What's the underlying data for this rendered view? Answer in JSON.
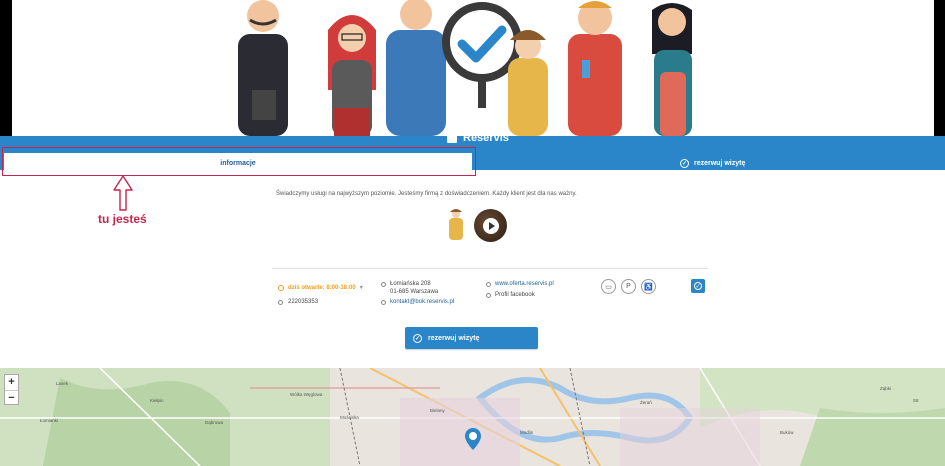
{
  "brand": {
    "name": "Reservis"
  },
  "tabs": {
    "info_label": "informacje",
    "book_label": "rezerwuj wizytę"
  },
  "annotation": {
    "text": "tu jesteś"
  },
  "description": "Świadczymy usługi na najwyższym poziomie. Jesteśmy firmą z doświadczeniem. Każdy klient jest dla nas ważny.",
  "contact": {
    "hours": "dziś otwarte: 8:00-18:00",
    "phone": "222035353",
    "address_line1": "Łomiańska 208",
    "address_line2": "01-685 Warszawa",
    "email": "kontakt@bok.reservis.pl",
    "website": "www.oferta.reservis.pl",
    "facebook": "Profil facebook"
  },
  "cta": {
    "label": "rezerwuj wizytę"
  },
  "map": {
    "zoom_in": "+",
    "zoom_out": "−",
    "labels": [
      "Lasek",
      "Łomianki",
      "Kiełpin",
      "Dąbrowa",
      "Wólka Węglowa",
      "Mościska",
      "Bielany",
      "Żerań",
      "Ząbki",
      "S8",
      "Modlin",
      "Buków"
    ]
  },
  "colors": {
    "accent": "#2a86c8",
    "annotation": "#c7254e",
    "hours": "#f0a020"
  }
}
